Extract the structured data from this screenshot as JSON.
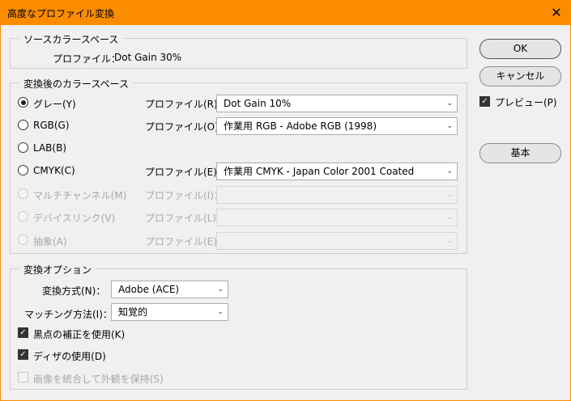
{
  "window": {
    "title": "高度なプロファイル変換",
    "close_glyph": "✕"
  },
  "source": {
    "legend": "ソースカラースペース",
    "profile_label": "プロファイル：",
    "profile_value": "Dot Gain 30%"
  },
  "dest": {
    "legend": "変換後のカラースペース",
    "rows": [
      {
        "label": "グレー(Y)",
        "profile_label": "プロファイル(R)：",
        "value": "Dot Gain 10%",
        "checked": true,
        "disabled": false
      },
      {
        "label": "RGB(G)",
        "profile_label": "プロファイル(O)：",
        "value": "作業用 RGB - Adobe RGB (1998)",
        "checked": false,
        "disabled": false
      },
      {
        "label": "LAB(B)",
        "profile_label": "",
        "value": "",
        "checked": false,
        "disabled": false
      },
      {
        "label": "CMYK(C)",
        "profile_label": "プロファイル(E)：",
        "value": "作業用 CMYK - Japan Color 2001 Coated",
        "checked": false,
        "disabled": false
      },
      {
        "label": "マルチチャンネル(M)",
        "profile_label": "プロファイル(I)：",
        "value": "",
        "checked": false,
        "disabled": true
      },
      {
        "label": "デバイスリンク(V)",
        "profile_label": "プロファイル(L)：",
        "value": "",
        "checked": false,
        "disabled": true
      },
      {
        "label": "抽象(A)",
        "profile_label": "プロファイル(E)：",
        "value": "",
        "checked": false,
        "disabled": true
      }
    ]
  },
  "options": {
    "legend": "変換オプション",
    "engine_label": "変換方式(N)：",
    "engine_value": "Adobe (ACE)",
    "intent_label": "マッチング方法(I)：",
    "intent_value": "知覚的",
    "bpc_label": "黒点の補正を使用(K)",
    "dither_label": "ディザの使用(D)",
    "flatten_label": "画像を統合して外観を保持(S)"
  },
  "buttons": {
    "ok": "OK",
    "cancel": "キャンセル",
    "preview": "プレビュー(P)",
    "basic": "基本"
  },
  "glyphs": {
    "check": "✓",
    "arrow": "⌄"
  }
}
